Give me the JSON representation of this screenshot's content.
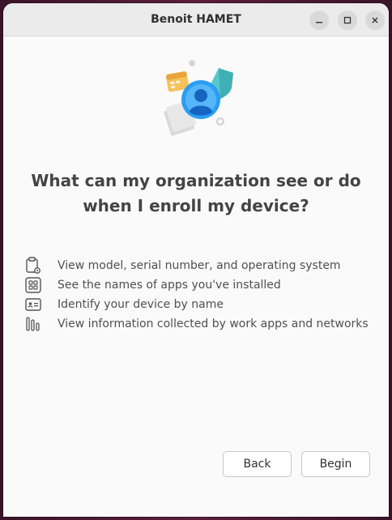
{
  "window": {
    "title": "Benoit HAMET",
    "controls": {
      "minimize": "–",
      "maximize": "□",
      "close": "✕"
    }
  },
  "hero": {
    "icons": [
      "calendar-icon",
      "user-avatar-icon",
      "shield-icon",
      "document-icon"
    ]
  },
  "main": {
    "question": "What can my organization see or do when I enroll my device?",
    "items": [
      {
        "icon": "clipboard-gear-icon",
        "label": "View model, serial number, and operating system"
      },
      {
        "icon": "apps-grid-icon",
        "label": "See the names of apps you've installed"
      },
      {
        "icon": "id-card-icon",
        "label": "Identify your device by name"
      },
      {
        "icon": "bar-chart-icon",
        "label": "View information collected by work apps and networks"
      }
    ]
  },
  "footer": {
    "back_label": "Back",
    "begin_label": "Begin"
  },
  "colors": {
    "accent_blue": "#1e88e5",
    "shield_teal": "#4cc3c9",
    "calendar_orange": "#f2b84b",
    "text": "#505050"
  }
}
